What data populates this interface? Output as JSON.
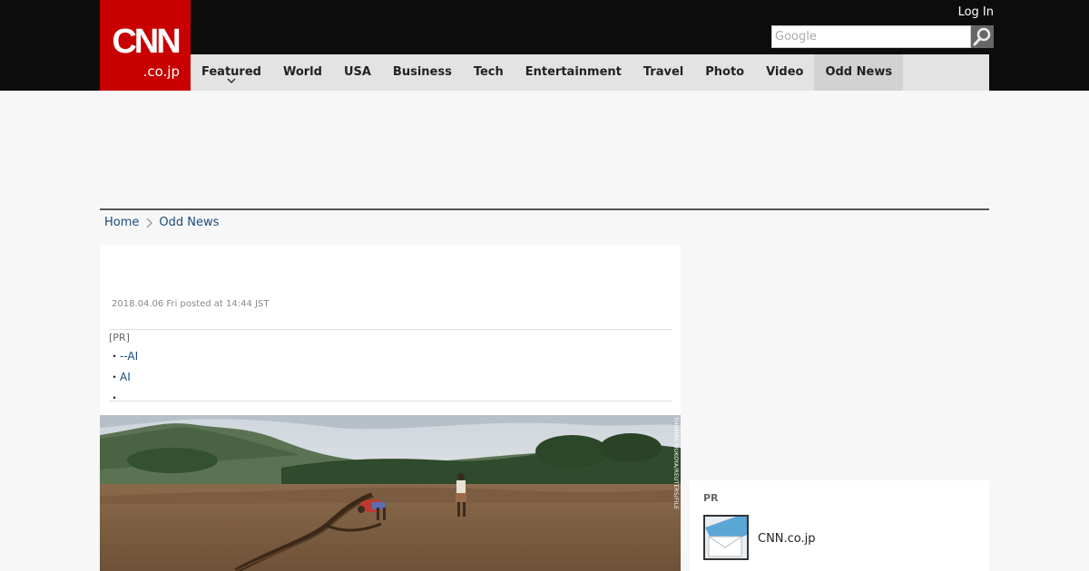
{
  "header": {
    "logo_main": "CNN",
    "logo_sub": ".co.jp",
    "login_label": "Log In",
    "search_placeholder": "Google"
  },
  "nav": {
    "items": [
      {
        "label": "Featured"
      },
      {
        "label": "World"
      },
      {
        "label": "USA"
      },
      {
        "label": "Business"
      },
      {
        "label": "Tech"
      },
      {
        "label": "Entertainment"
      },
      {
        "label": "Travel"
      },
      {
        "label": "Photo"
      },
      {
        "label": "Video"
      },
      {
        "label": "Odd News"
      }
    ],
    "active": "Odd News"
  },
  "breadcrumb": {
    "home": "Home",
    "current": "Odd News"
  },
  "article": {
    "date": "2018.04.06 Fri posted at 14:44 JST",
    "pr_label": "[PR]",
    "pr_links": [
      "--AI",
      "AI",
      ""
    ],
    "photo_credit": "THOMAS MUKOYA/REUTERS/FILE"
  },
  "sidebar": {
    "title": "PR",
    "item_text": "CNN.co.jp"
  },
  "colors": {
    "brand_red": "#c90000",
    "header_bg": "#0c0c0c",
    "nav_bg": "#e3e3e3",
    "link": "#1a4a7a"
  }
}
